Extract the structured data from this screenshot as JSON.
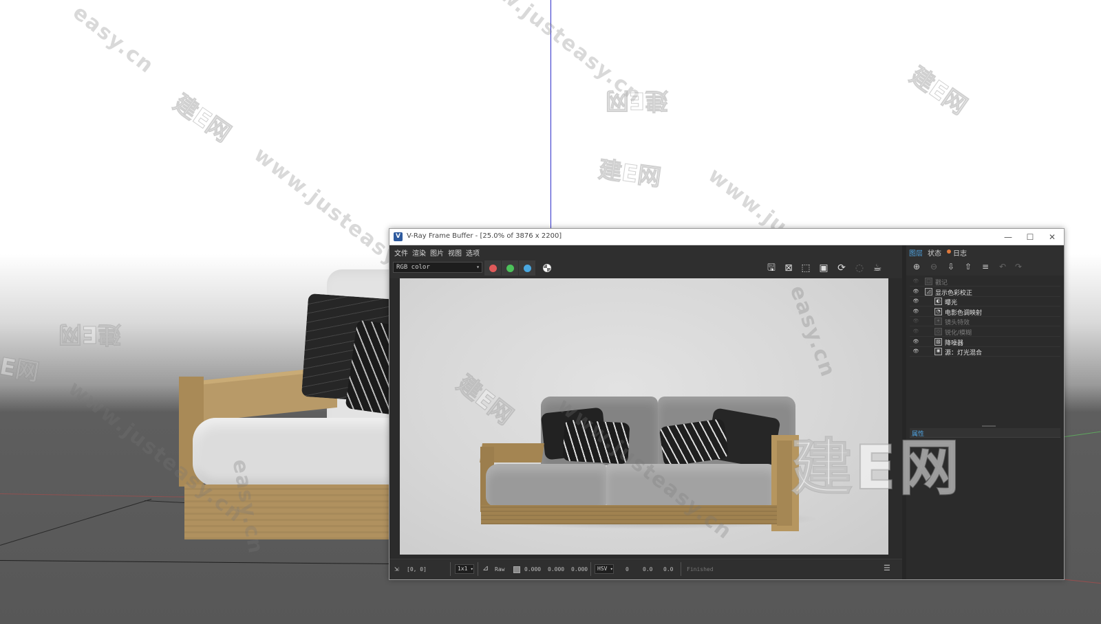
{
  "window": {
    "title": "V-Ray Frame Buffer - [25.0% of 3876 x 2200]",
    "app_icon": "V",
    "controls": {
      "minimize": "—",
      "maximize": "☐",
      "close": "✕"
    }
  },
  "menu": {
    "items": [
      "文件",
      "渲染",
      "图片",
      "视图",
      "选项"
    ]
  },
  "toolbar": {
    "channel": "RGB color",
    "channel_colors": {
      "red": "#e05a5a",
      "green": "#4cc25a",
      "blue": "#4aa8e0"
    },
    "icons": [
      "save-icon",
      "clear-icon",
      "region-icon",
      "fit-icon",
      "render-icon",
      "stop-icon",
      "teapot-icon"
    ]
  },
  "statusbar": {
    "coords": "[0, 0]",
    "zoom": "1x1",
    "raw_label": "Raw",
    "raw_values": [
      "0.000",
      "0.000",
      "0.000"
    ],
    "color_mode": "HSV",
    "hsv_values": [
      "0",
      "0.0",
      "0.0"
    ],
    "status": "Finished"
  },
  "right_panel": {
    "tabs": [
      "图层",
      "状态",
      "日志"
    ],
    "active_tab": "图层",
    "layers": [
      {
        "label": "戳记",
        "enabled": false,
        "indent": 1,
        "icon": "stamp-icon"
      },
      {
        "label": "显示色彩校正",
        "enabled": true,
        "indent": 1,
        "icon": "curve-icon"
      },
      {
        "label": "曝光",
        "enabled": true,
        "indent": 2,
        "icon": "exposure-icon"
      },
      {
        "label": "电影色调映射",
        "enabled": true,
        "indent": 2,
        "icon": "tonemap-icon"
      },
      {
        "label": "镜头特效",
        "enabled": false,
        "indent": 2,
        "icon": "lens-icon"
      },
      {
        "label": "锐化/模糊",
        "enabled": false,
        "indent": 2,
        "icon": "sharpen-icon"
      },
      {
        "label": "降噪器",
        "enabled": true,
        "indent": 2,
        "icon": "denoiser-icon"
      },
      {
        "label": "源：灯光混合",
        "enabled": true,
        "indent": 2,
        "icon": "lightmix-icon"
      }
    ],
    "properties_label": "属性"
  },
  "watermarks": {
    "url": "www.justeasy.cn",
    "url_short": "easy.cn",
    "cn": "建E网",
    "cn_short": "E网",
    "big": "建E网"
  },
  "colors": {
    "accent": "#4fa3e0",
    "log_dot": "#e07a3c",
    "axis_blue": "#2b2bc9"
  }
}
